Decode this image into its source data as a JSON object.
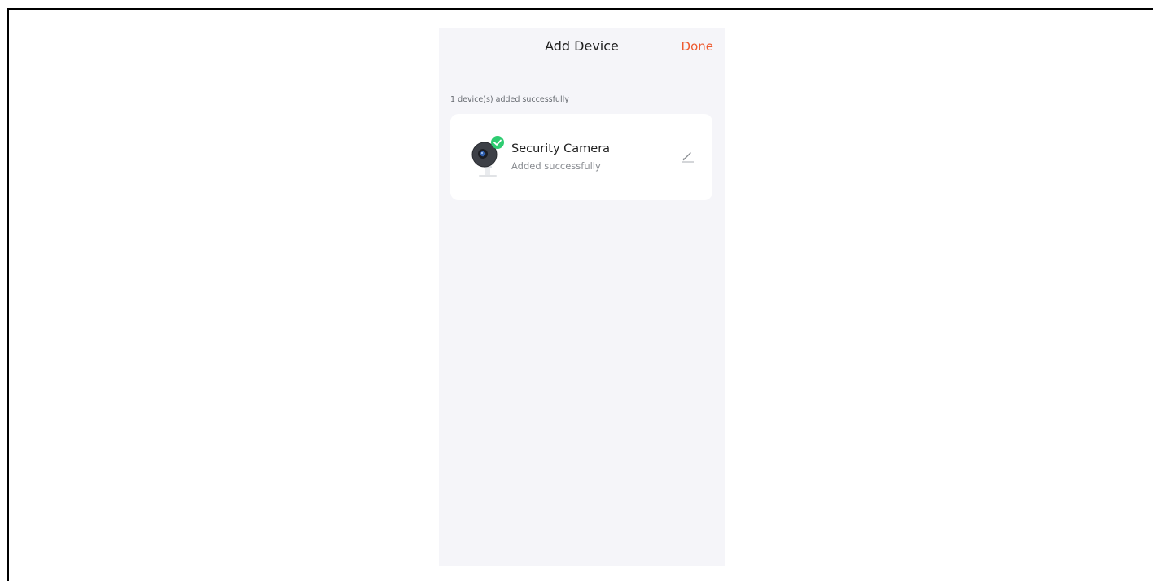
{
  "header": {
    "title": "Add Device",
    "done_label": "Done"
  },
  "section": {
    "label": "1 device(s) added successfully"
  },
  "devices": [
    {
      "name": "Security Camera",
      "status": "Added successfully",
      "icon": "security-camera-icon",
      "badge_icon": "check-circle-icon",
      "action_icon": "pencil-edit-icon"
    }
  ],
  "colors": {
    "accent": "#ee5a2f",
    "success": "#2ecc71",
    "background": "#f5f5f9",
    "card": "#ffffff"
  }
}
